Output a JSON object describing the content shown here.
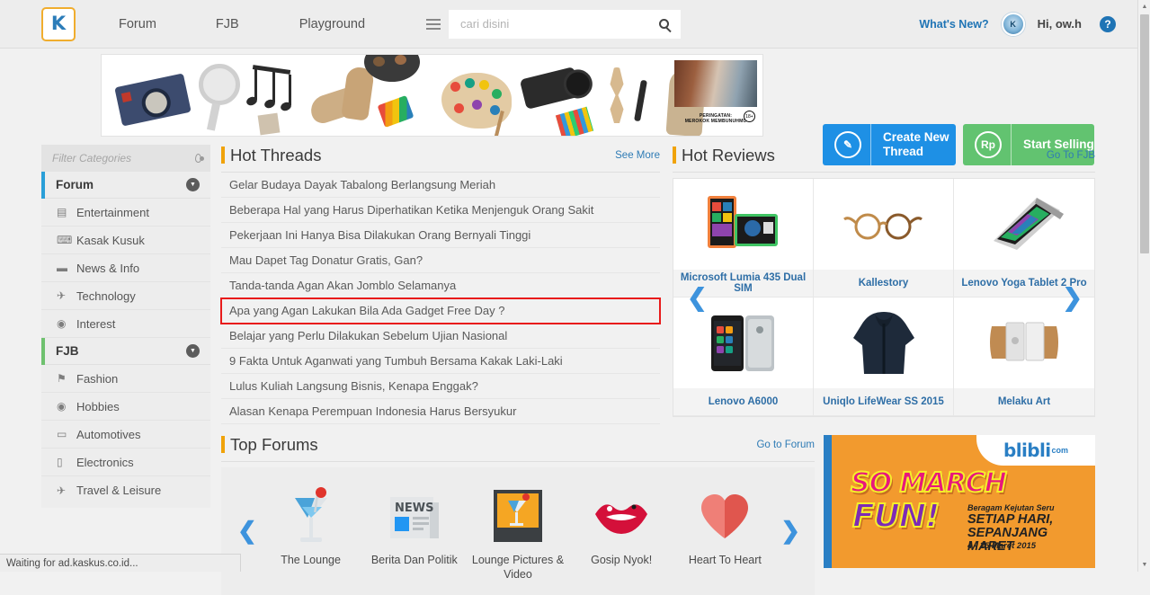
{
  "topnav": {
    "logo": "K",
    "links": [
      {
        "label": "Forum",
        "name": "nav-forum"
      },
      {
        "label": "FJB",
        "name": "nav-fjb"
      },
      {
        "label": "Playground",
        "name": "nav-playground"
      }
    ],
    "search": {
      "value": "",
      "placeholder": "cari disini"
    },
    "whats_new": "What's New?",
    "greeting": "Hi, ow.h",
    "help": "?"
  },
  "header_buttons": {
    "create_thread": {
      "icon_label": "✎",
      "label": "Create New\nThread",
      "color": "#1e90e5"
    },
    "start_selling": {
      "icon_label": "Rp",
      "label": "Start Selling",
      "color": "#62c370"
    }
  },
  "ad_banner": {
    "warning_line1": "PERINGATAN:",
    "warning_line2": "MEROKOK MEMBUNUHMU",
    "age_badge": "18+"
  },
  "sidebar": {
    "filter": {
      "value": "",
      "placeholder": "Filter Categories"
    },
    "groups": [
      {
        "title": "Forum",
        "accent": "#2a9fd8",
        "items": [
          {
            "label": "Entertainment",
            "icon": "▤"
          },
          {
            "label": "Kasak Kusuk",
            "icon": "⌨"
          },
          {
            "label": "News & Info",
            "icon": "▬"
          },
          {
            "label": "Technology",
            "icon": "✈"
          },
          {
            "label": "Interest",
            "icon": "◉"
          }
        ]
      },
      {
        "title": "FJB",
        "accent": "#6fc16f",
        "items": [
          {
            "label": "Fashion",
            "icon": "⚑"
          },
          {
            "label": "Hobbies",
            "icon": "◉"
          },
          {
            "label": "Automotives",
            "icon": "▭"
          },
          {
            "label": "Electronics",
            "icon": "▯"
          },
          {
            "label": "Travel & Leisure",
            "icon": "✈"
          }
        ]
      }
    ]
  },
  "hot_threads": {
    "title": "Hot Threads",
    "see_more": "See More",
    "items": [
      {
        "label": "Gelar Budaya Dayak Tabalong Berlangsung Meriah",
        "highlighted": false
      },
      {
        "label": "Beberapa Hal yang Harus Diperhatikan Ketika Menjenguk Orang Sakit",
        "highlighted": false
      },
      {
        "label": "Pekerjaan Ini Hanya Bisa Dilakukan Orang Bernyali Tinggi",
        "highlighted": false
      },
      {
        "label": "Mau Dapet Tag Donatur Gratis, Gan?",
        "highlighted": false
      },
      {
        "label": "Tanda-tanda Agan Akan Jomblo Selamanya",
        "highlighted": false
      },
      {
        "label": "Apa yang Agan Lakukan Bila Ada Gadget Free Day ?",
        "highlighted": true
      },
      {
        "label": "Belajar yang Perlu Dilakukan Sebelum Ujian Nasional",
        "highlighted": false
      },
      {
        "label": "9 Fakta Untuk Aganwati yang Tumbuh Bersama Kakak Laki-Laki",
        "highlighted": false
      },
      {
        "label": "Lulus Kuliah Langsung Bisnis, Kenapa Enggak?",
        "highlighted": false
      },
      {
        "label": "Alasan Kenapa Perempuan Indonesia Harus Bersyukur",
        "highlighted": false
      }
    ]
  },
  "hot_reviews": {
    "title": "Hot Reviews",
    "go_link": "Go To FJB",
    "prev": "❮",
    "next": "❯",
    "items": [
      {
        "name": "Microsoft Lumia 435 Dual SIM",
        "kind": "phone"
      },
      {
        "name": "Kallestory",
        "kind": "glasses"
      },
      {
        "name": "Lenovo Yoga Tablet 2 Pro",
        "kind": "laptop"
      },
      {
        "name": "Lenovo A6000",
        "kind": "phone2"
      },
      {
        "name": "Uniqlo LifeWear SS 2015",
        "kind": "hoodie"
      },
      {
        "name": "Melaku Art",
        "kind": "stand"
      }
    ]
  },
  "top_forums": {
    "title": "Top Forums",
    "go_link": "Go to Forum",
    "prev": "❮",
    "next": "❯",
    "items": [
      {
        "label": "The Lounge",
        "kind": "cocktail"
      },
      {
        "label": "Berita Dan Politik",
        "kind": "news"
      },
      {
        "label": "Lounge Pictures & Video",
        "kind": "photo"
      },
      {
        "label": "Gosip Nyok!",
        "kind": "lips"
      },
      {
        "label": "Heart To Heart",
        "kind": "heart"
      }
    ]
  },
  "blibli_ad": {
    "logo_main": "blibli",
    "logo_sub": "com",
    "headline1": "SO MARCH",
    "headline2": "FUN!",
    "sub1": "Beragam Kejutan Seru",
    "sub2": "SETIAP HARI,\nSEPANJANG MARET",
    "sub3": "4 - 25 Maret 2015"
  },
  "statusbar": {
    "text": "Waiting for ad.kaskus.co.id..."
  }
}
